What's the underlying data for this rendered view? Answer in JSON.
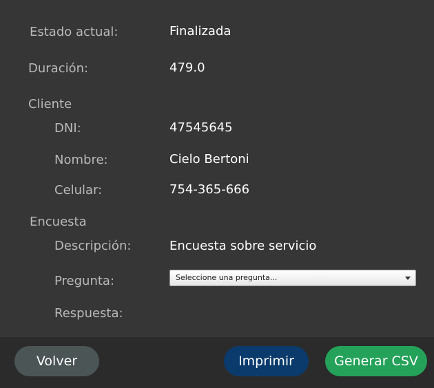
{
  "fields": {
    "estado_label": "Estado actual:",
    "estado_value": "Finalizada",
    "duracion_label": "Duración:",
    "duracion_value": "479.0"
  },
  "cliente": {
    "section_label": "Cliente",
    "dni_label": "DNI:",
    "dni_value": "47545645",
    "nombre_label": "Nombre:",
    "nombre_value": "Cielo Bertoni",
    "celular_label": "Celular:",
    "celular_value": "754-365-666"
  },
  "encuesta": {
    "section_label": "Encuesta",
    "descripcion_label": "Descripción:",
    "descripcion_value": "Encuesta sobre servicio",
    "pregunta_label": "Pregunta:",
    "pregunta_placeholder": "Seleccione una pregunta...",
    "respuesta_label": "Respuesta:"
  },
  "footer": {
    "volver_label": "Volver",
    "imprimir_label": "Imprimir",
    "csv_label": "Generar CSV"
  },
  "colors": {
    "background": "#363636",
    "footer_background": "#2b2b2b",
    "volver_button": "#4c5556",
    "imprimir_button": "#0b3b6c",
    "csv_button": "#25a25a"
  }
}
